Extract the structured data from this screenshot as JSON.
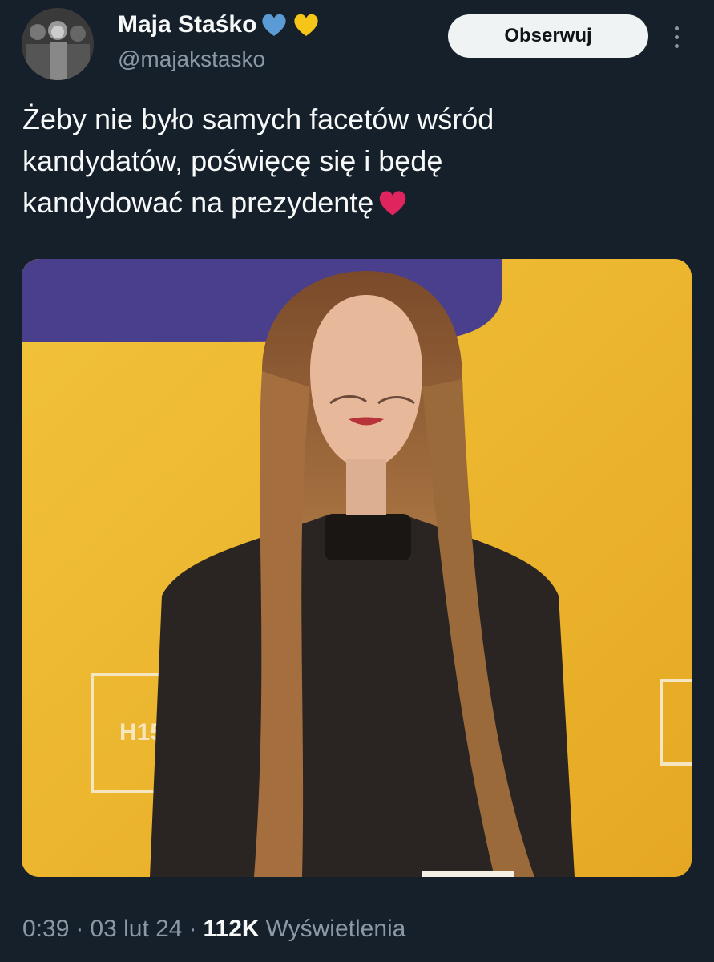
{
  "author": {
    "name": "Maja Staśko",
    "name_emojis": [
      "blue-heart",
      "yellow-heart"
    ],
    "handle": "@majakstasko"
  },
  "follow_button": {
    "label": "Obserwuj"
  },
  "more_menu": {
    "icon": "more-vertical-icon"
  },
  "tweet": {
    "text_lines": [
      "Żeby nie było samych facetów wśród",
      "kandydatów, poświęcę się i będę",
      "kandydować na prezydentę"
    ],
    "trailing_emoji": "red-heart",
    "image": {
      "sign_text": "H15"
    }
  },
  "meta": {
    "time": "0:39",
    "separator": "·",
    "date": "03 lut 24",
    "views_count": "112K",
    "views_label": "Wyświetlenia"
  },
  "colors": {
    "background": "#15202b",
    "primary_text": "#f7f9f9",
    "secondary_text": "#8b98a5",
    "follow_bg": "#eff3f4",
    "blue_heart": "#5b9bd5",
    "yellow_heart": "#f5c518",
    "red_heart": "#e0245e"
  }
}
